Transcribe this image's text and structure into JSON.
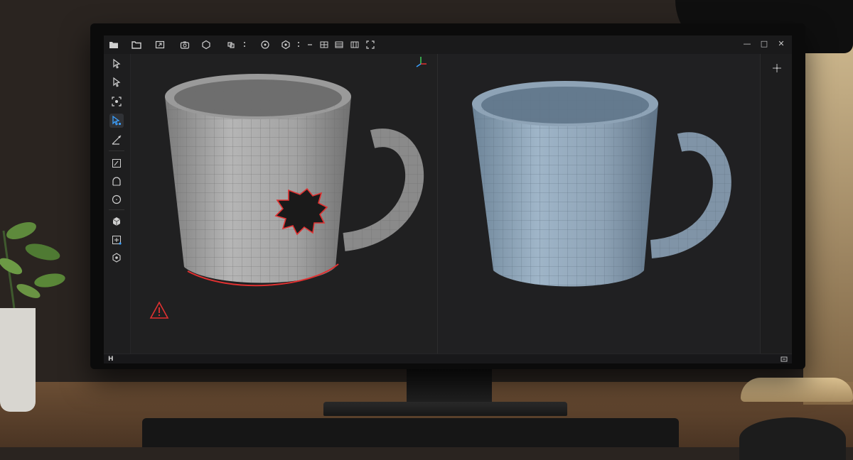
{
  "app": {
    "toolbar": {
      "items": [
        "open-folder-icon",
        "folder-icon",
        "export-icon",
        "camera-icon",
        "hexagon-icon",
        "cube-link-icon",
        "more-vertical-icon",
        "target-icon",
        "gear-icon",
        "more-vertical-icon",
        "minus-icon",
        "grid-a-icon",
        "grid-b-icon",
        "grid-c-icon",
        "frame-icon"
      ],
      "window_controls": [
        "—",
        "□",
        "✕"
      ]
    },
    "sidebar": {
      "items": [
        "select-icon",
        "select-alt-icon",
        "focus-icon",
        "select-active-icon",
        "measure-icon",
        "sketch-icon",
        "arch-icon",
        "circle-icon",
        "cube-icon",
        "add-icon",
        "gear-circle-icon"
      ],
      "active_index": 3
    },
    "status": {
      "left_label": "H"
    },
    "viewports": {
      "left": {
        "warning": "warning-icon",
        "gizmo": "axis-gizmo-icon"
      },
      "right": {
        "gizmo": "axis-gizmo-icon"
      }
    },
    "colors": {
      "accent_red": "#e03131",
      "mesh_gray": "#9a9a9a",
      "mesh_blue": "#8da5ba",
      "highlight_blue": "#3ba0ff"
    }
  }
}
